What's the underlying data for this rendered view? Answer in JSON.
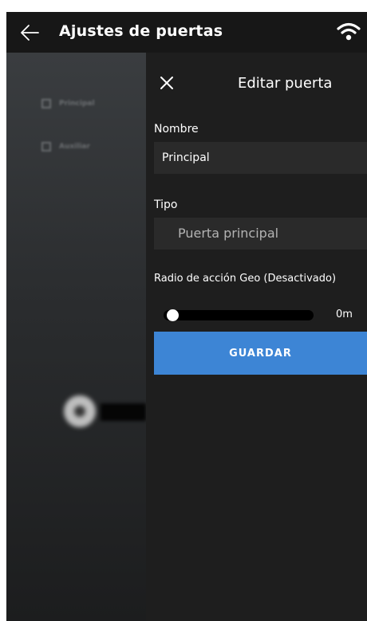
{
  "header": {
    "title": "Ajustes de puertas",
    "back_icon": "arrow-left-icon",
    "status_icon": "wifi-icon"
  },
  "background_list": {
    "items": [
      {
        "label": "Principal",
        "icon": "edit-icon"
      },
      {
        "label": "Auxiliar",
        "icon": "edit-icon"
      }
    ]
  },
  "panel": {
    "title": "Editar puerta",
    "close_icon": "close-icon",
    "name": {
      "label": "Nombre",
      "value": "Principal"
    },
    "type": {
      "label": "Tipo",
      "value": "Puerta principal"
    },
    "geo": {
      "label": "Radio de acción Geo (Desactivado)",
      "value": "0m",
      "level": 0
    },
    "save_label": "GUARDAR"
  },
  "colors": {
    "accent": "#3d85d5",
    "panel_bg": "#1e1e1e",
    "header_bg": "#171717",
    "input_bg": "#2a2a2a"
  }
}
